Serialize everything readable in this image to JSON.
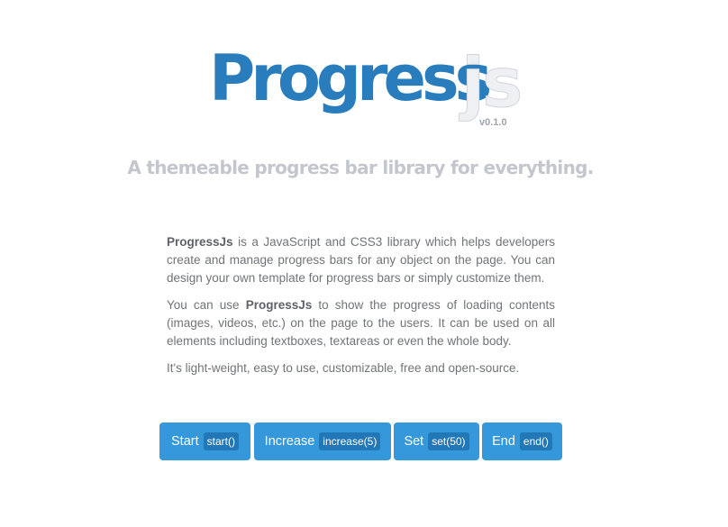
{
  "logo": {
    "main": "Progress",
    "suffix": "js",
    "version": "v0.1.0"
  },
  "tagline": "A themeable progress bar library for everything.",
  "description": {
    "p1": {
      "bold": "ProgressJs",
      "text": " is a JavaScript and CSS3 library which helps developers create and manage progress bars for any object on the page. You can design your own template for progress bars or simply customize them."
    },
    "p2": {
      "before": "You can use ",
      "bold": "ProgressJs",
      "after": " to show the progress of loading contents (images, videos, etc.) on the page to the users. It can be used on all elements including textboxes, textareas or even the whole body."
    },
    "p3": "It's light-weight, easy to use, customizable, free and open-source."
  },
  "buttons": [
    {
      "label": "Start",
      "code": "start()"
    },
    {
      "label": "Increase",
      "code": "increase(5)"
    },
    {
      "label": "Set",
      "code": "set(50)"
    },
    {
      "label": "End",
      "code": "end()"
    }
  ],
  "colors": {
    "brand": "#2a7dbd",
    "button": "#3498db",
    "button_code": "#2278b7",
    "tagline": "#c3c7cd",
    "body_text": "#707479"
  }
}
